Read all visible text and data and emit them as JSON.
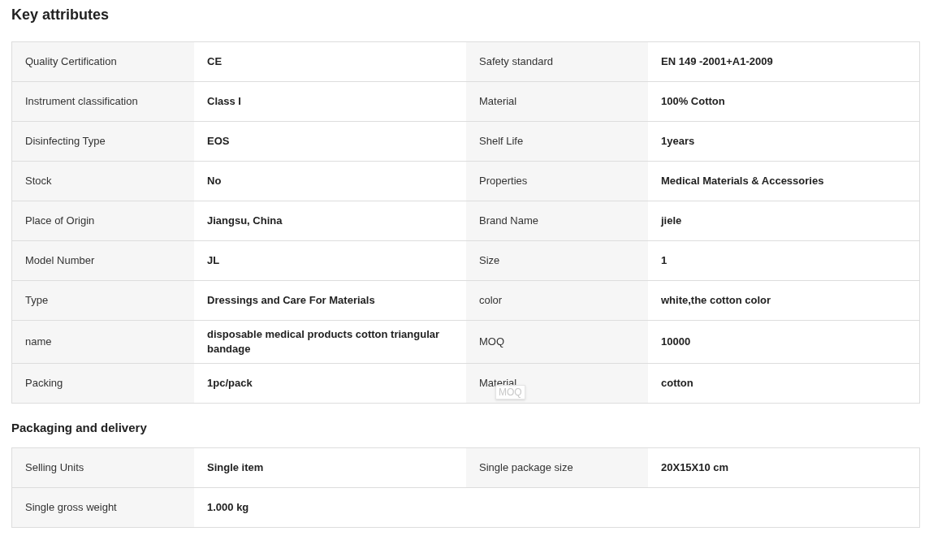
{
  "sections": [
    {
      "title": "Key attributes",
      "rows": [
        [
          {
            "label": "Quality Certification",
            "value": "CE"
          },
          {
            "label": "Safety standard",
            "value": "EN 149 -2001+A1-2009"
          }
        ],
        [
          {
            "label": "Instrument classification",
            "value": "Class I"
          },
          {
            "label": "Material",
            "value": "100% Cotton"
          }
        ],
        [
          {
            "label": "Disinfecting Type",
            "value": "EOS"
          },
          {
            "label": "Shelf Life",
            "value": "1years"
          }
        ],
        [
          {
            "label": "Stock",
            "value": "No"
          },
          {
            "label": "Properties",
            "value": "Medical Materials & Accessories"
          }
        ],
        [
          {
            "label": "Place of Origin",
            "value": "Jiangsu, China"
          },
          {
            "label": "Brand Name",
            "value": "jiele"
          }
        ],
        [
          {
            "label": "Model Number",
            "value": "JL"
          },
          {
            "label": "Size",
            "value": "1"
          }
        ],
        [
          {
            "label": "Type",
            "value": "Dressings and Care For Materials"
          },
          {
            "label": "color",
            "value": "white,the cotton color"
          }
        ],
        [
          {
            "label": "name",
            "value": "disposable medical products cotton triangular bandage"
          },
          {
            "label": "MOQ",
            "value": "10000"
          }
        ],
        [
          {
            "label": "Packing",
            "value": "1pc/pack"
          },
          {
            "label": "Material",
            "value": "cotton",
            "tooltip": "MOQ"
          }
        ]
      ]
    },
    {
      "title": "Packaging and delivery",
      "rows": [
        [
          {
            "label": "Selling Units",
            "value": "Single item"
          },
          {
            "label": "Single package size",
            "value": "20X15X10 cm"
          }
        ],
        [
          {
            "label": "Single gross weight",
            "value": "1.000 kg"
          }
        ]
      ]
    }
  ]
}
